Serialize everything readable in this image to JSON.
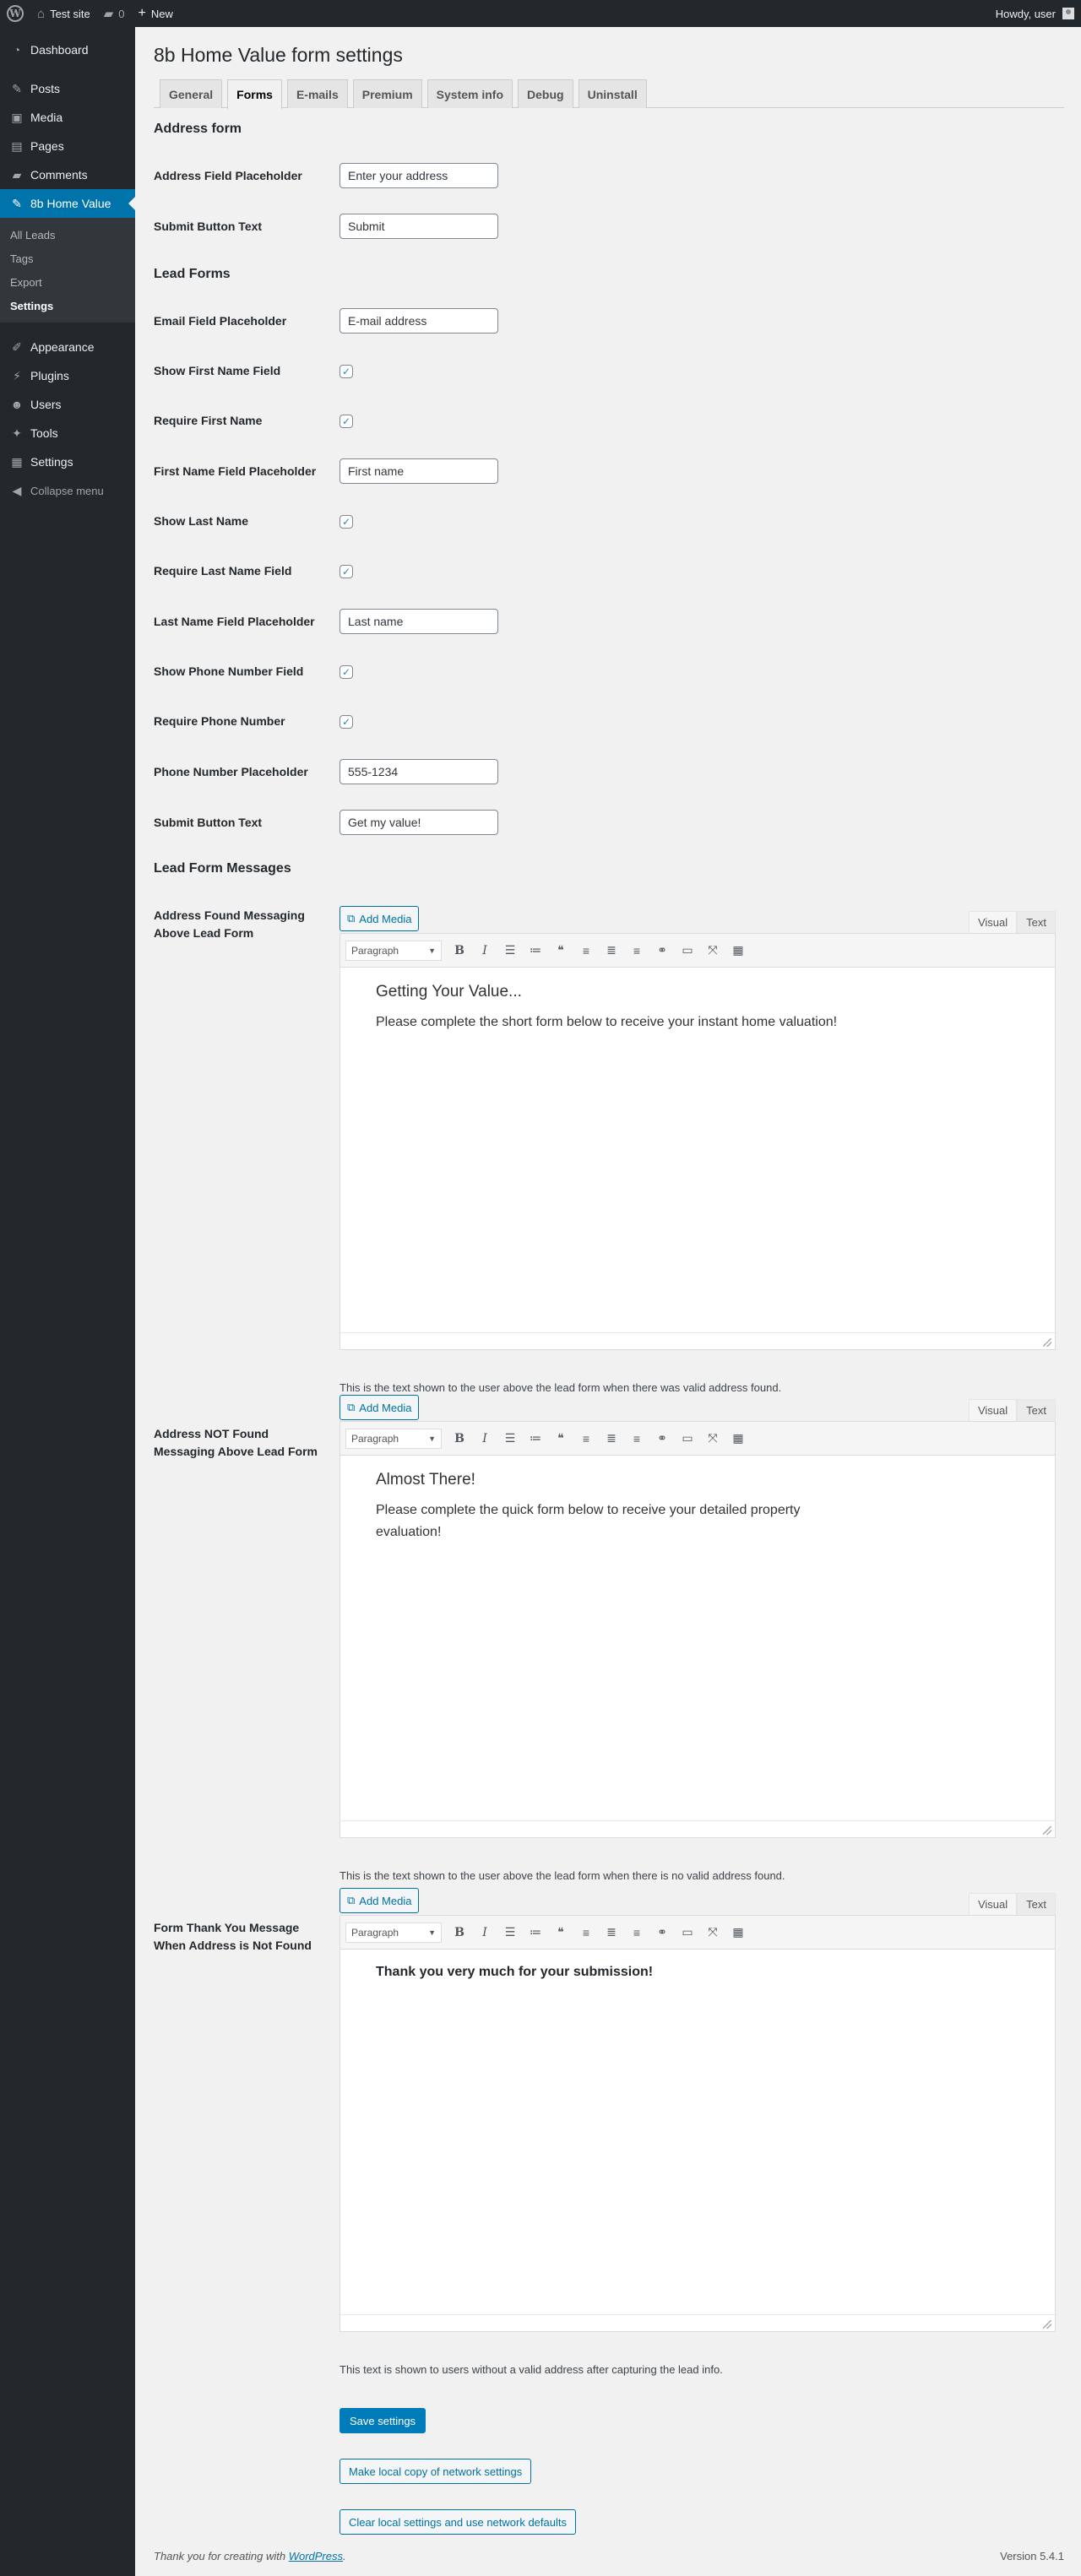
{
  "adminbar": {
    "site_name": "Test site",
    "comments_count": "0",
    "new_label": "New",
    "howdy": "Howdy, user"
  },
  "sidebar": {
    "items": [
      {
        "label": "Dashboard",
        "icon": "dashboard-icon"
      },
      {
        "label": "Posts",
        "icon": "pushpin-icon"
      },
      {
        "label": "Media",
        "icon": "media-icon"
      },
      {
        "label": "Pages",
        "icon": "pages-icon"
      },
      {
        "label": "Comments",
        "icon": "comment-icon"
      },
      {
        "label": "8b Home Value",
        "icon": "pushpin-icon"
      },
      {
        "label": "Appearance",
        "icon": "paintbrush-icon"
      },
      {
        "label": "Plugins",
        "icon": "plugin-icon"
      },
      {
        "label": "Users",
        "icon": "users-icon"
      },
      {
        "label": "Tools",
        "icon": "wrench-icon"
      },
      {
        "label": "Settings",
        "icon": "settings-icon"
      }
    ],
    "submenu": [
      "All Leads",
      "Tags",
      "Export",
      "Settings"
    ],
    "collapse_label": "Collapse menu"
  },
  "page": {
    "title": "8b Home Value form settings",
    "tabs": [
      "General",
      "Forms",
      "E-mails",
      "Premium",
      "System info",
      "Debug",
      "Uninstall"
    ],
    "active_tab": "Forms"
  },
  "address_form": {
    "section_title": "Address form",
    "address_placeholder_label": "Address Field Placeholder",
    "address_placeholder_value": "Enter your address",
    "submit_label": "Submit Button Text",
    "submit_value": "Submit"
  },
  "lead_forms": {
    "section_title": "Lead Forms",
    "email_label": "Email Field Placeholder",
    "email_value": "E-mail address",
    "show_first_label": "Show First Name Field",
    "require_first_label": "Require First Name",
    "first_placeholder_label": "First Name Field Placeholder",
    "first_placeholder_value": "First name",
    "show_last_label": "Show Last Name",
    "require_last_label": "Require Last Name Field",
    "last_placeholder_label": "Last Name Field Placeholder",
    "last_placeholder_value": "Last name",
    "show_phone_label": "Show Phone Number Field",
    "require_phone_label": "Require Phone Number",
    "phone_placeholder_label": "Phone Number Placeholder",
    "phone_placeholder_value": "555-1234",
    "submit_label": "Submit Button Text",
    "submit_value": "Get my value!",
    "checkbox_mark": "✓"
  },
  "messages": {
    "section_title": "Lead Form Messages",
    "add_media": "Add Media",
    "visual_tab": "Visual",
    "text_tab": "Text",
    "format_select": "Paragraph",
    "found": {
      "label": "Address Found Messaging Above Lead Form",
      "heading": "Getting Your Value...",
      "body": "Please complete the short form below to receive your instant home valuation!",
      "description": "This is the text shown to the user above the lead form when there was valid address found."
    },
    "not_found": {
      "label": "Address NOT Found Messaging Above Lead Form",
      "heading": "Almost There!",
      "body": "Please complete the quick form below to receive your detailed property evaluation!",
      "description": "This is the text shown to the user above the lead form when there is no valid address found."
    },
    "thank_you": {
      "label": "Form Thank You Message When Address is Not Found",
      "body": "Thank you very much for your submission!",
      "description": "This text is shown to users without a valid address after capturing the lead info."
    }
  },
  "actions": {
    "save": "Save settings",
    "copy_network": "Make local copy of network settings",
    "clear_local": "Clear local settings and use network defaults"
  },
  "footer": {
    "thanks_prefix": "Thank you for creating with ",
    "thanks_link": "WordPress",
    "thanks_suffix": ".",
    "version": "Version 5.4.1"
  },
  "colors": {
    "admin_bg": "#23282d",
    "accent": "#0073aa",
    "primary_button": "#007cba"
  }
}
